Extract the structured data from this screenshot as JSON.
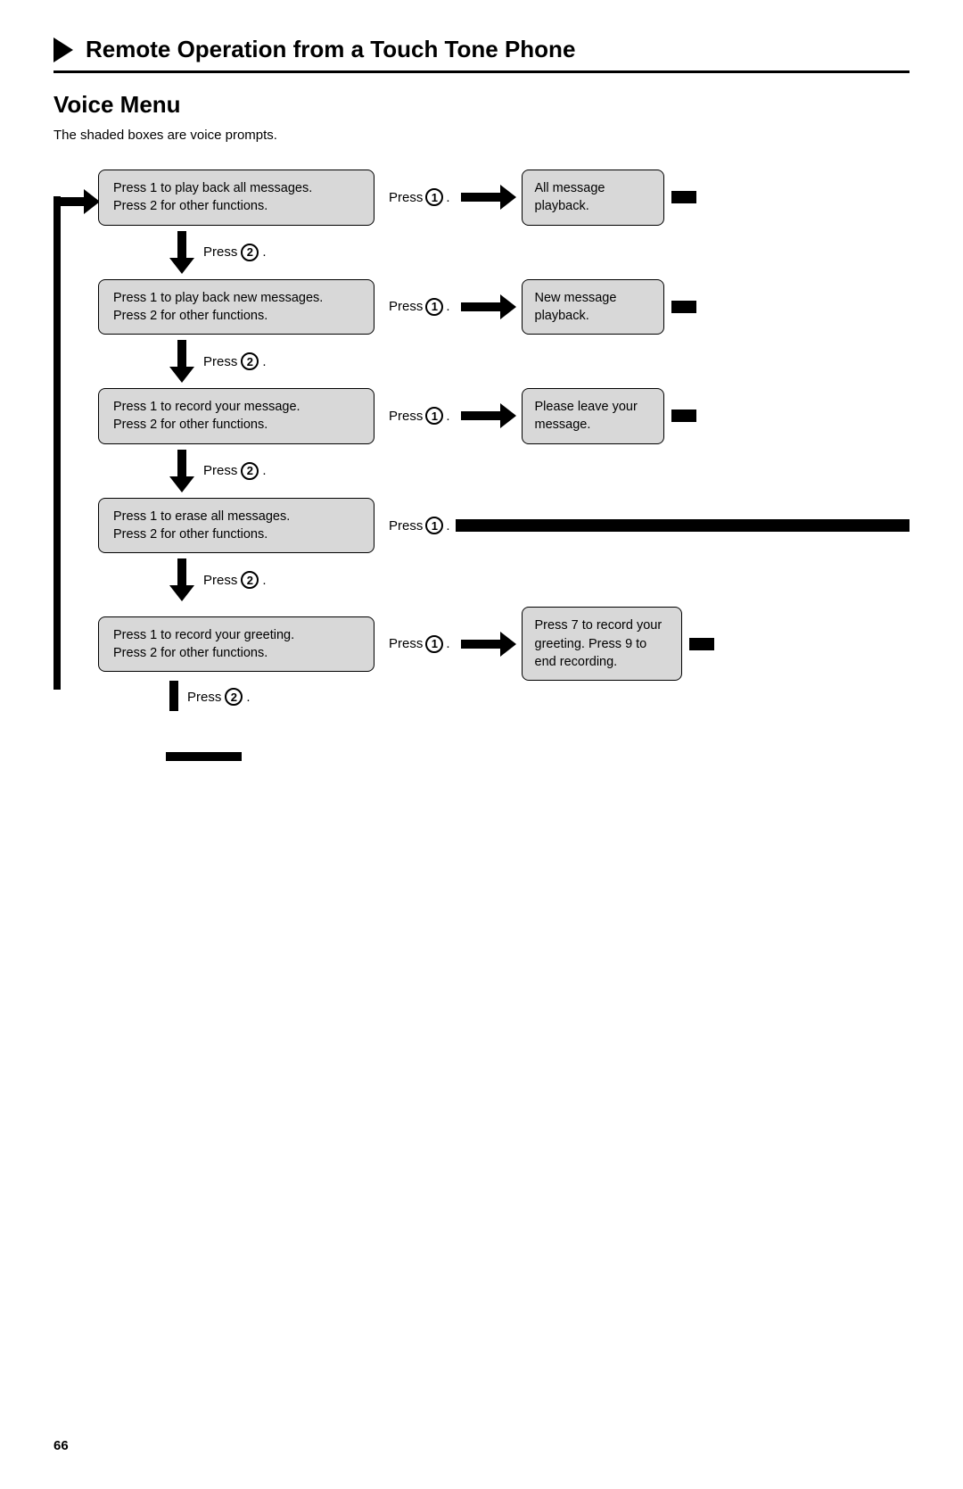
{
  "header": {
    "title": "Remote Operation from a Touch Tone Phone"
  },
  "section": {
    "title": "Voice Menu",
    "subtitle": "The shaded boxes are voice prompts."
  },
  "flow": {
    "rows": [
      {
        "id": "row1",
        "left_line1": "Press 1 to play back all messages.",
        "left_line2": "Press 2 for other functions.",
        "press_label": "Press",
        "press_number": "1",
        "right_text": "All message playback.",
        "press2_label": "Press",
        "press2_number": "2"
      },
      {
        "id": "row2",
        "left_line1": "Press 1 to play back new messages.",
        "left_line2": "Press 2 for other functions.",
        "press_label": "Press",
        "press_number": "1",
        "right_text": "New message playback.",
        "press2_label": "Press",
        "press2_number": "2"
      },
      {
        "id": "row3",
        "left_line1": "Press 1 to record your message.",
        "left_line2": "Press 2 for other functions.",
        "press_label": "Press",
        "press_number": "1",
        "right_text": "Please leave your message.",
        "press2_label": "Press",
        "press2_number": "2"
      },
      {
        "id": "row4",
        "left_line1": "Press 1 to erase all messages.",
        "left_line2": "Press 2 for other functions.",
        "press_label": "Press",
        "press_number": "1",
        "right_text": null,
        "press2_label": "Press",
        "press2_number": "2"
      },
      {
        "id": "row5",
        "left_line1": "Press 1 to record your greeting.",
        "left_line2": "Press 2 for other functions.",
        "press_label": "Press",
        "press_number": "1",
        "right_text": "Press 7 to record your greeting. Press 9 to end recording.",
        "press2_label": "Press",
        "press2_number": "2",
        "is_last": true
      }
    ]
  },
  "page_number": "66"
}
